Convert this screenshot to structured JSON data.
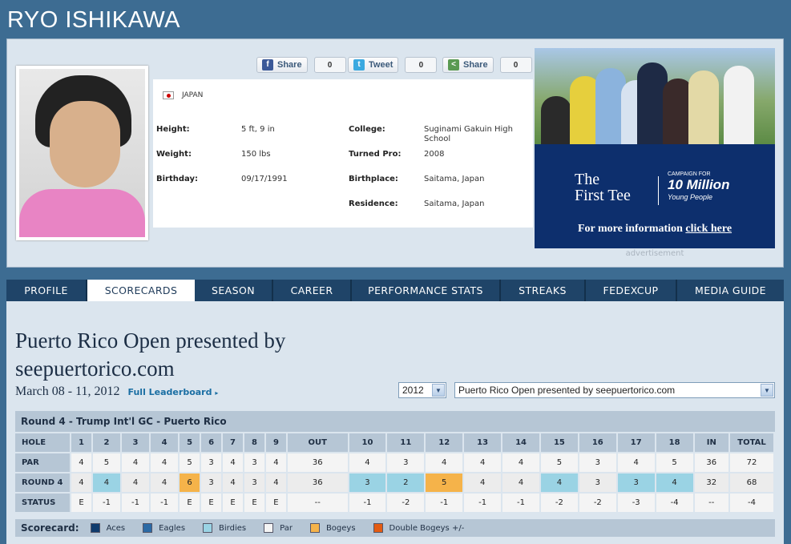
{
  "player": {
    "name": "RYO ISHIKAWA",
    "country": "JAPAN",
    "height_label": "Height:",
    "height": "5 ft, 9 in",
    "weight_label": "Weight:",
    "weight": "150 lbs",
    "birthday_label": "Birthday:",
    "birthday": "09/17/1991",
    "college_label": "College:",
    "college": "Suginami Gakuin High School",
    "turned_pro_label": "Turned Pro:",
    "turned_pro": "2008",
    "birthplace_label": "Birthplace:",
    "birthplace": "Saitama, Japan",
    "residence_label": "Residence:",
    "residence": "Saitama, Japan"
  },
  "social": {
    "facebook_label": "Share",
    "facebook_count": "0",
    "twitter_label": "Tweet",
    "twitter_count": "0",
    "share_label": "Share",
    "share_count": "0"
  },
  "ad": {
    "brand_line1": "The",
    "brand_line2": "First Tee",
    "campaign_small": "CAMPAIGN FOR",
    "campaign_big": "10 Million",
    "campaign_sub": "Young People",
    "cta_text": "For more information",
    "cta_link": "click here",
    "label": "advertisement"
  },
  "tabs": [
    {
      "label": "PROFILE"
    },
    {
      "label": "SCORECARDS"
    },
    {
      "label": "SEASON"
    },
    {
      "label": "CAREER"
    },
    {
      "label": "PERFORMANCE STATS"
    },
    {
      "label": "STREAKS"
    },
    {
      "label": "FEDEXCUP"
    },
    {
      "label": "MEDIA GUIDE"
    }
  ],
  "tournament": {
    "title": "Puerto Rico Open presented by seepuertorico.com",
    "dates": "March 08 - 11, 2012",
    "leaderboard_link": "Full Leaderboard",
    "year_select": "2012",
    "event_select": "Puerto Rico Open presented by seepuertorico.com"
  },
  "scorecard": {
    "round_header": "Round 4 - Trump Int'l GC - Puerto Rico",
    "row_labels": {
      "hole": "HOLE",
      "par": "PAR",
      "round": "ROUND 4",
      "status": "STATUS"
    },
    "holes": [
      "1",
      "2",
      "3",
      "4",
      "5",
      "6",
      "7",
      "8",
      "9",
      "OUT",
      "10",
      "11",
      "12",
      "13",
      "14",
      "15",
      "16",
      "17",
      "18",
      "IN",
      "TOTAL"
    ],
    "par": [
      "4",
      "5",
      "4",
      "4",
      "5",
      "3",
      "4",
      "3",
      "4",
      "36",
      "4",
      "3",
      "4",
      "4",
      "4",
      "5",
      "3",
      "4",
      "5",
      "36",
      "72"
    ],
    "round": [
      "4",
      "4",
      "4",
      "4",
      "6",
      "3",
      "4",
      "3",
      "4",
      "36",
      "3",
      "2",
      "5",
      "4",
      "4",
      "4",
      "3",
      "3",
      "4",
      "32",
      "68"
    ],
    "round_types": [
      "par",
      "birdie",
      "par",
      "par",
      "bogey",
      "par",
      "par",
      "par",
      "par",
      "",
      "birdie",
      "birdie",
      "bogey",
      "par",
      "par",
      "birdie",
      "par",
      "birdie",
      "birdie",
      "",
      ""
    ],
    "status": [
      "E",
      "-1",
      "-1",
      "-1",
      "E",
      "E",
      "E",
      "E",
      "E",
      "--",
      "-1",
      "-2",
      "-1",
      "-1",
      "-1",
      "-2",
      "-2",
      "-3",
      "-4",
      "--",
      "-4"
    ]
  },
  "legend": {
    "title": "Scorecard:",
    "items": [
      {
        "label": "Aces",
        "color": "#0f3b6d"
      },
      {
        "label": "Eagles",
        "color": "#2b6aa5"
      },
      {
        "label": "Birdies",
        "color": "#9ad3e4"
      },
      {
        "label": "Par",
        "color": "#f4f4f4"
      },
      {
        "label": "Bogeys",
        "color": "#f5b34a"
      },
      {
        "label": "Double Bogeys +/-",
        "color": "#e35b12"
      }
    ]
  }
}
